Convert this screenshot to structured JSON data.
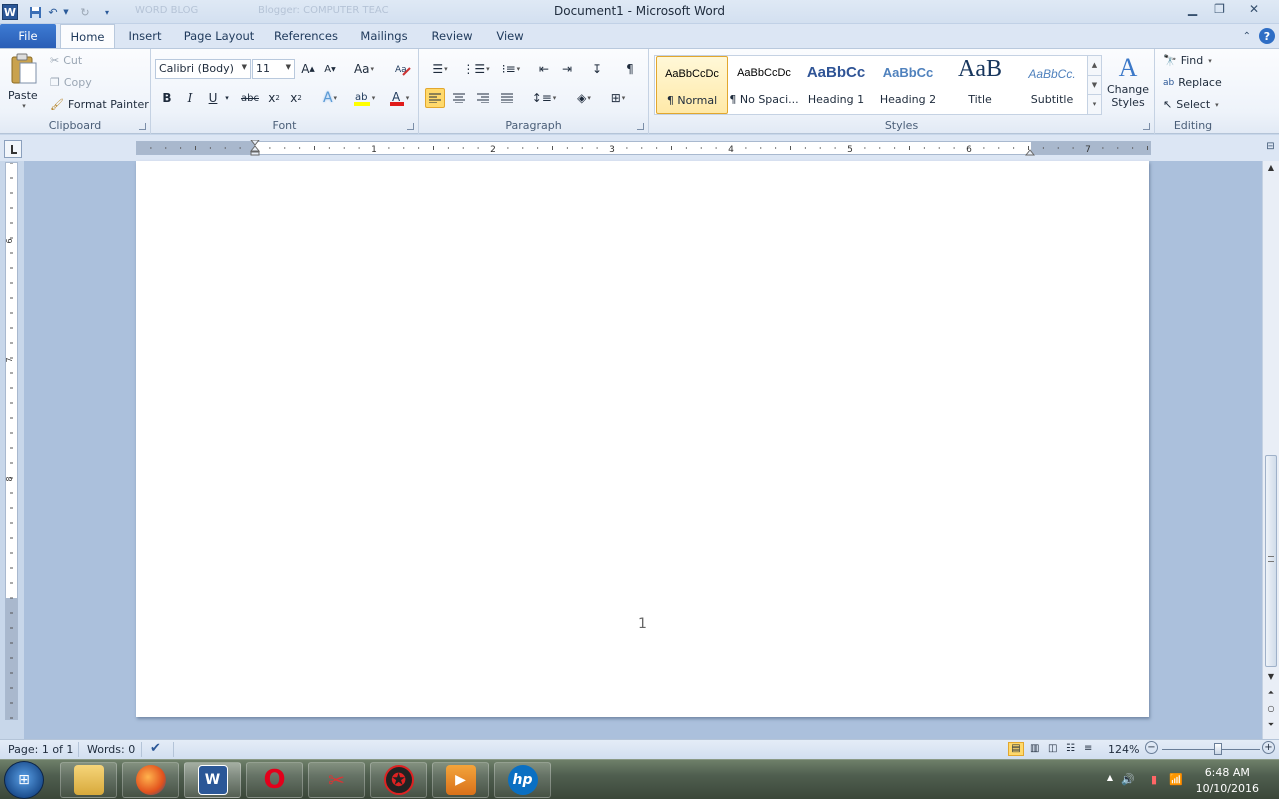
{
  "window": {
    "title": "Document1  -  Microsoft Word",
    "ghost_tab1": "WORD BLOG",
    "ghost_tab2": "Blogger: COMPUTER TEAC"
  },
  "tabs": [
    {
      "label": "File"
    },
    {
      "label": "Home"
    },
    {
      "label": "Insert"
    },
    {
      "label": "Page Layout"
    },
    {
      "label": "References"
    },
    {
      "label": "Mailings"
    },
    {
      "label": "Review"
    },
    {
      "label": "View"
    }
  ],
  "clipboard": {
    "paste": "Paste",
    "cut": "Cut",
    "copy": "Copy",
    "format_painter": "Format Painter",
    "group": "Clipboard"
  },
  "font": {
    "name": "Calibri (Body)",
    "size": "11",
    "group": "Font",
    "bold": "B",
    "italic": "I",
    "underline": "U",
    "strike": "abc",
    "change_case": "Aa"
  },
  "paragraph": {
    "group": "Paragraph",
    "pilcrow": "¶"
  },
  "styles": {
    "group": "Styles",
    "items": [
      {
        "preview": "AaBbCcDc",
        "name": "¶ Normal"
      },
      {
        "preview": "AaBbCcDc",
        "name": "¶ No Spaci..."
      },
      {
        "preview": "AaBbCc",
        "name": "Heading 1"
      },
      {
        "preview": "AaBbCc",
        "name": "Heading 2"
      },
      {
        "preview": "AaB",
        "name": "Title"
      },
      {
        "preview": "AaBbCc.",
        "name": "Subtitle"
      }
    ],
    "change_styles": "Change Styles"
  },
  "editing": {
    "group": "Editing",
    "find": "Find",
    "replace": "Replace",
    "select": "Select"
  },
  "ruler": {
    "numbers": [
      "1",
      "1",
      "2",
      "3",
      "4",
      "5",
      "6",
      "7"
    ],
    "v_numbers": [
      "6",
      "7",
      "8"
    ]
  },
  "document": {
    "page_number": "1"
  },
  "status": {
    "page": "Page: 1 of 1",
    "words": "Words: 0",
    "zoom": "124%",
    "zoom_pct": 62
  },
  "taskbar": {
    "time": "6:48 AM",
    "date": "10/10/2016",
    "apps": [
      "explorer",
      "firefox",
      "word",
      "opera",
      "snipping",
      "game",
      "media",
      "hp"
    ]
  },
  "colors": {
    "accent": "#2b5797",
    "highlight": "#ffd96b",
    "font_color": "#e01b1b",
    "highlight_color": "#ffff00"
  }
}
